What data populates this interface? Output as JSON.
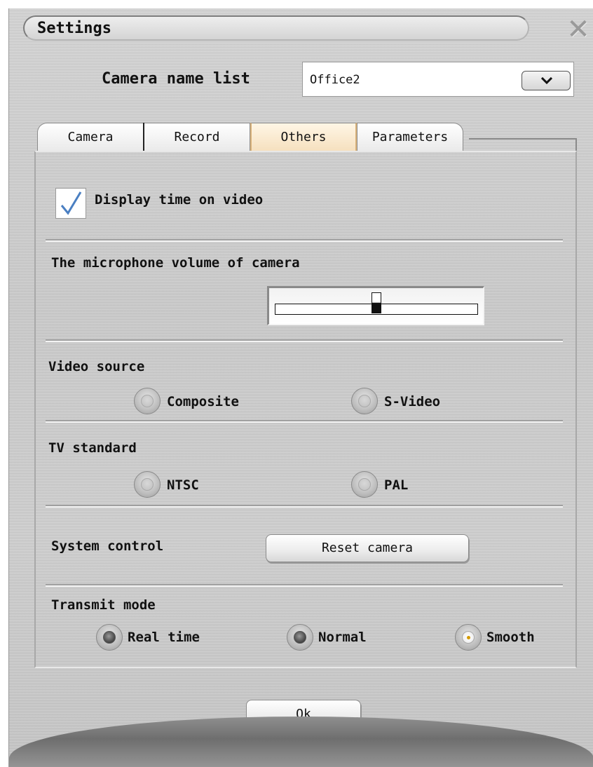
{
  "window": {
    "title": "Settings"
  },
  "camera_list": {
    "label": "Camera name list",
    "selected": "Office2"
  },
  "tabs": [
    {
      "label": "Camera",
      "active": false
    },
    {
      "label": "Record",
      "active": false
    },
    {
      "label": "Others",
      "active": true
    },
    {
      "label": "Parameters",
      "active": false
    }
  ],
  "display_time": {
    "label": "Display time on video",
    "checked": true
  },
  "microphone": {
    "label": "The microphone volume of camera",
    "level": 0.5
  },
  "video_source": {
    "label": "Video source",
    "options": [
      "Composite",
      "S-Video"
    ]
  },
  "tv_standard": {
    "label": "TV standard",
    "options": [
      "NTSC",
      "PAL"
    ]
  },
  "system_control": {
    "label": "System control",
    "reset_button": "Reset camera"
  },
  "transmit_mode": {
    "label": "Transmit mode",
    "options": [
      "Real time",
      "Normal",
      "Smooth"
    ],
    "selected": "Smooth"
  },
  "ok_button": "Ok",
  "colors": {
    "active_tab": "#f5dfbd",
    "selected_dot": "#d49a00"
  }
}
